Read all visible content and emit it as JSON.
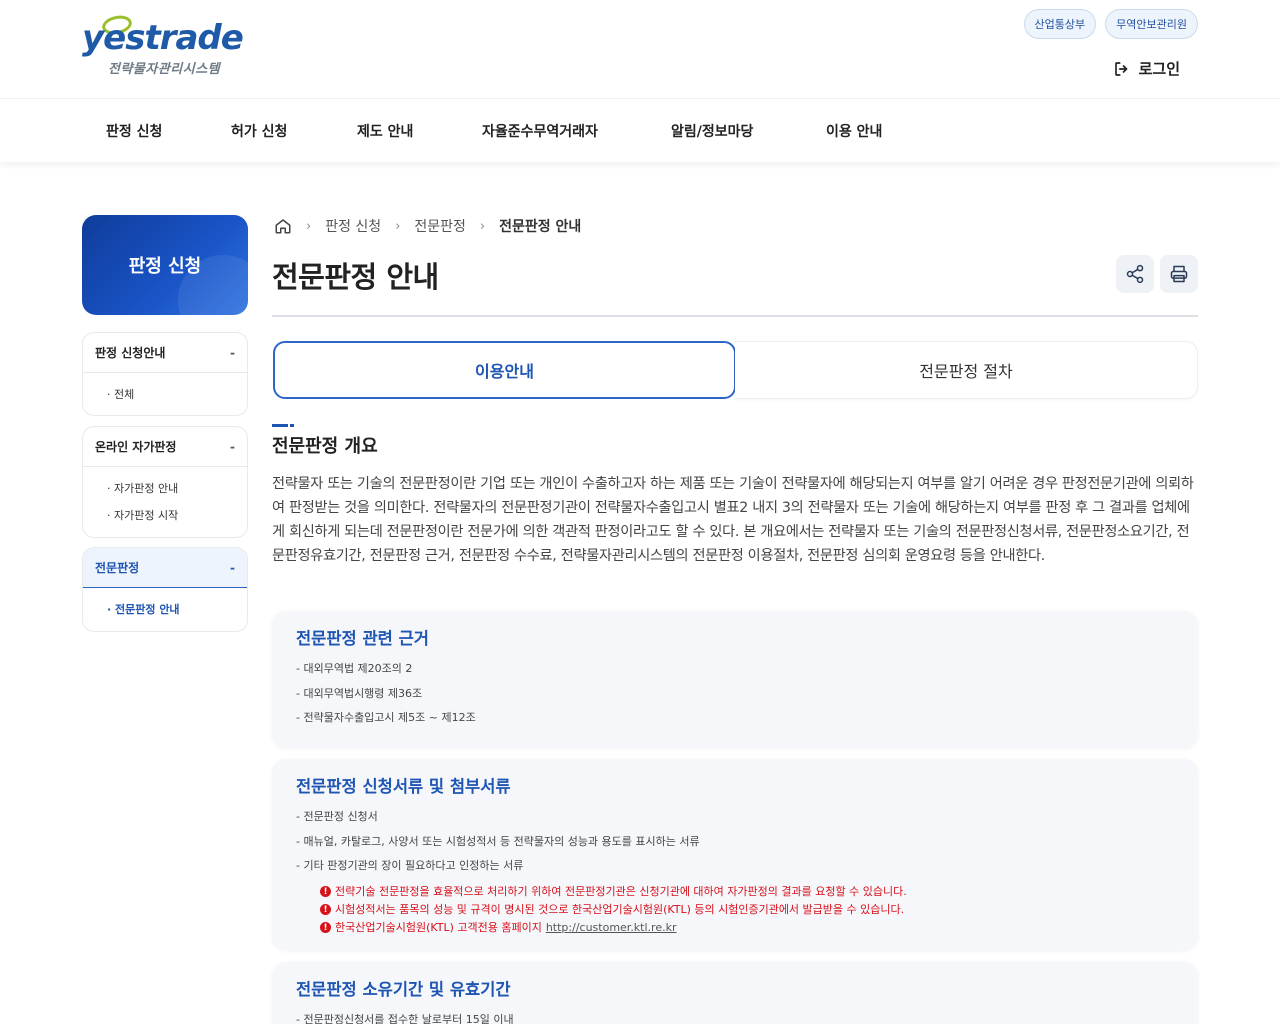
{
  "header": {
    "logo_text": "yestrade",
    "logo_sub": "전략물자관리시스템",
    "top_links": [
      "산업통상부",
      "무역안보관리원"
    ],
    "login_label": "로그인"
  },
  "nav": {
    "items": [
      "판정 신청",
      "허가 신청",
      "제도 안내",
      "자율준수무역거래자",
      "알림/정보마당",
      "이용 안내"
    ]
  },
  "sidebar": {
    "banner": "판정 신청",
    "groups": [
      {
        "title": "판정 신청안내",
        "toggle": "-",
        "items": [
          "· 전체"
        ]
      },
      {
        "title": "온라인 자가판정",
        "toggle": "-",
        "items": [
          "· 자가판정 안내",
          "· 자가판정 시작"
        ]
      },
      {
        "title": "전문판정",
        "toggle": "-",
        "items": [
          "· 전문판정 안내"
        ]
      }
    ]
  },
  "breadcrumb": {
    "items": [
      "판정 신청",
      "전문판정"
    ],
    "current": "전문판정 안내"
  },
  "page": {
    "title": "전문판정 안내",
    "tabs": [
      "이용안내",
      "전문판정 절차"
    ],
    "section_title": "전문판정 개요",
    "intro": "전략물자 또는 기술의 전문판정이란 기업 또는 개인이 수출하고자 하는 제품 또는 기술이 전략물자에 해당되는지 여부를 알기 어려운 경우 판정전문기관에 의뢰하여 판정받는 것을 의미한다. 전략물자의 전문판정기관이 전략물자수출입고시 별표2 내지 3의 전략물자 또는 기술에 해당하는지 여부를 판정 후 그 결과를 업체에게 회신하게 되는데 전문판정이란 전문가에 의한 객관적 판정이라고도 할 수 있다. 본 개요에서는 전략물자 또는 기술의 전문판정신청서류, 전문판정소요기간, 전문판정유효기간, 전문판정 근거, 전문판정 수수료, 전략물자관리시스템의 전문판정 이용절차, 전문판정 심의회 운영요령 등을 안내한다."
  },
  "cards": [
    {
      "title": "전문판정 관련 근거",
      "lines": [
        "- 대외무역법 제20조의 2",
        "- 대외무역법시행령 제36조",
        "- 전략물자수출입고시 제5조 ~ 제12조"
      ]
    },
    {
      "title": "전문판정 신청서류 및 첨부서류",
      "lines": [
        "- 전문판정 신청서",
        "- 매뉴얼, 카탈로그, 사양서 또는 시험성적서 등 전략물자의 성능과 용도를 표시하는 서류",
        "- 기타 판정기관의 장이 필요하다고 인정하는 서류"
      ],
      "notes": [
        "전략기술 전문판정을 효율적으로 처리하기 위하여 전문판정기관은 신청기관에 대하여 자가판정의 결과를 요청할 수 있습니다.",
        "시험성적서는 품목의 성능 및 규격이 명시된 것으로 한국산업기술시험원(KTL) 등의 시험인증기관에서 발급받을 수 있습니다.",
        "한국산업기술시험원(KTL) 고객전용 홈페이지"
      ],
      "link": "http://customer.ktl.re.kr"
    },
    {
      "title": "전문판정 소유기간 및 유효기간",
      "lines": [
        "- 전문판정신청서를 접수한 날로부터 15일 이내"
      ]
    }
  ],
  "colors": {
    "accent": "#1e55b3",
    "warning": "#d8101a",
    "banner": "#1a55c8"
  }
}
